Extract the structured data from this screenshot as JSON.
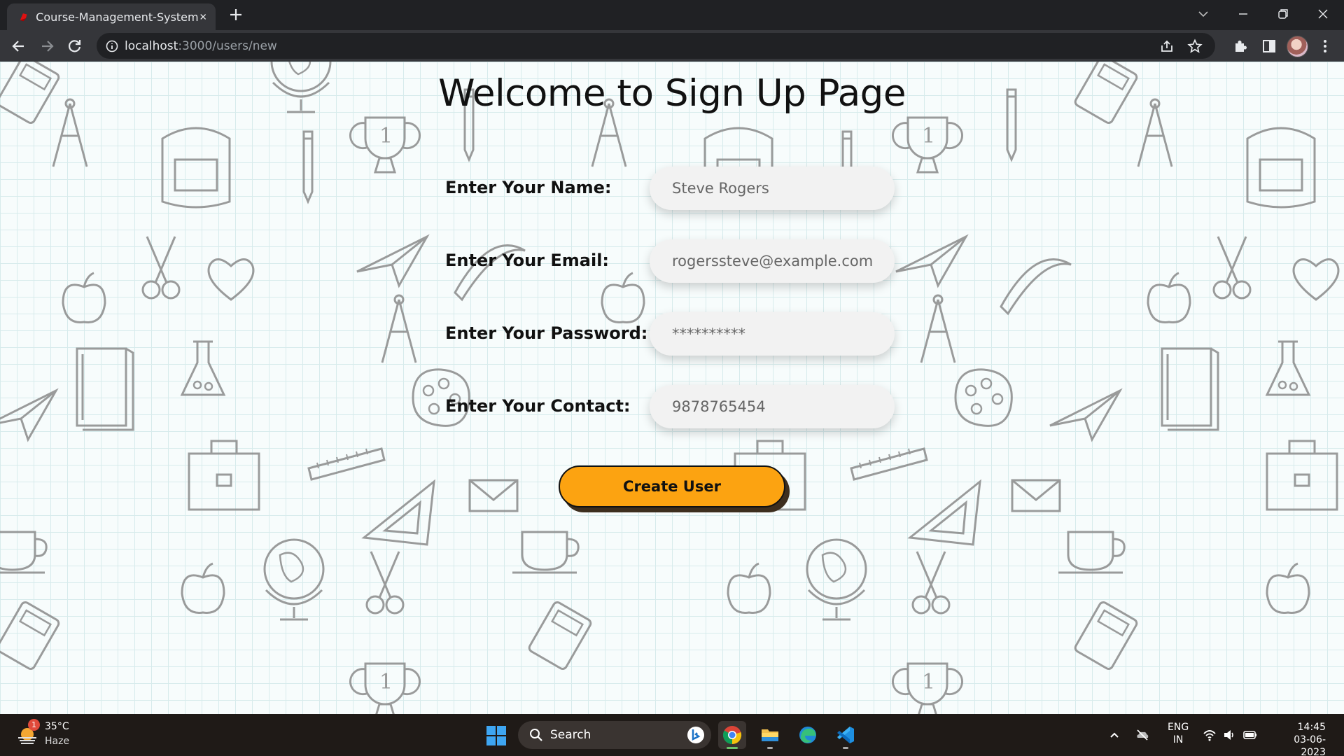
{
  "browser": {
    "tab_title": "Course-Management-System",
    "url_host": "localhost",
    "url_path": ":3000/users/new"
  },
  "page": {
    "heading": "Welcome to Sign Up Page",
    "fields": [
      {
        "label": "Enter Your Name:",
        "placeholder": "Steve Rogers",
        "type": "text"
      },
      {
        "label": "Enter Your Email:",
        "placeholder": "rogerssteve@example.com",
        "type": "email"
      },
      {
        "label": "Enter Your Password:",
        "placeholder": "**********",
        "type": "password"
      },
      {
        "label": "Enter Your Contact:",
        "placeholder": "9878765454",
        "type": "tel"
      }
    ],
    "submit_label": "Create User",
    "button_color": "#fca311"
  },
  "taskbar": {
    "weather_badge": "1",
    "weather_temp": "35°C",
    "weather_condition": "Haze",
    "search_label": "Search",
    "language_top": "ENG",
    "language_bottom": "IN",
    "time": "14:45",
    "date": "03-06-2023"
  },
  "icons": {
    "tab_favicon": "ruby-favicon-icon",
    "back": "back-arrow-icon",
    "forward": "forward-arrow-icon",
    "reload": "reload-icon",
    "info": "info-icon",
    "share": "share-icon",
    "bookmark": "star-icon",
    "extensions": "puzzle-icon",
    "side_panel": "side-panel-icon",
    "menu": "kebab-menu-icon"
  }
}
